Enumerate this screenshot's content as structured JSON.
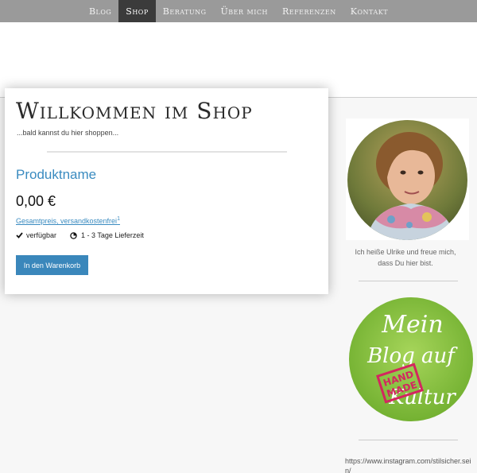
{
  "nav": {
    "items": [
      {
        "label": "Blog",
        "active": false
      },
      {
        "label": "Shop",
        "active": true
      },
      {
        "label": "Beratung",
        "active": false
      },
      {
        "label": "Über mich",
        "active": false
      },
      {
        "label": "Referenzen",
        "active": false
      },
      {
        "label": "Kontakt",
        "active": false
      }
    ]
  },
  "shop": {
    "title": "Willkommen im Shop",
    "subtitle": "...bald kannst du hier shoppen...",
    "product_name": "Produktname",
    "price": "0,00 €",
    "price_note": "Gesamtpreis, versandkostenfrei",
    "price_note_sup": "1",
    "availability": "verfügbar",
    "delivery": "1 - 3 Tage Lieferzeit",
    "cart_button": "In den Warenkorb"
  },
  "sidebar": {
    "intro_line1": "Ich heiße Ulrike und freue mich,",
    "intro_line2": "dass Du hier bist.",
    "blog_badge_text": [
      "Mein",
      "Blog auf",
      "Kultur"
    ],
    "stamp_text": [
      "HAND",
      "MADE"
    ],
    "instagram_url": "https://www.instagram.com/stilsicher.sein/"
  },
  "colors": {
    "nav_bg": "#9a9a9a",
    "nav_active": "#3b3b3b",
    "accent_blue": "#3a87bb",
    "badge_green": "#8cc63e",
    "stamp_pink": "#d3265f"
  },
  "icons": {
    "availability": "check-icon",
    "delivery": "clock-icon"
  }
}
